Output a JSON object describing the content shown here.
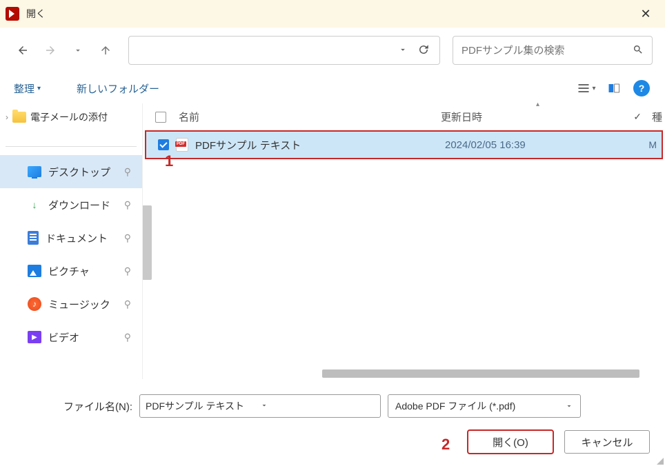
{
  "titlebar": {
    "title": "開く"
  },
  "search": {
    "placeholder": "PDFサンプル集の検索"
  },
  "toolbar": {
    "organize": "整理",
    "new_folder": "新しいフォルダー"
  },
  "tree": {
    "top_item": "電子メールの添付"
  },
  "quick_access": [
    {
      "label": "デスクトップ",
      "icon": "desktop",
      "selected": true
    },
    {
      "label": "ダウンロード",
      "icon": "download"
    },
    {
      "label": "ドキュメント",
      "icon": "doc"
    },
    {
      "label": "ピクチャ",
      "icon": "pic"
    },
    {
      "label": "ミュージック",
      "icon": "music"
    },
    {
      "label": "ビデオ",
      "icon": "video"
    }
  ],
  "columns": {
    "name": "名前",
    "date": "更新日時",
    "type": "種"
  },
  "files": [
    {
      "name": "PDFサンプル テキスト",
      "date": "2024/02/05 16:39",
      "type_short": "M",
      "selected": true
    }
  ],
  "filename": {
    "label": "ファイル名(N):",
    "value": "PDFサンプル テキスト"
  },
  "filter": {
    "value": "Adobe PDF ファイル (*.pdf)"
  },
  "buttons": {
    "open": "開く(O)",
    "cancel": "キャンセル"
  },
  "annotations": {
    "a1": "1",
    "a2": "2"
  }
}
